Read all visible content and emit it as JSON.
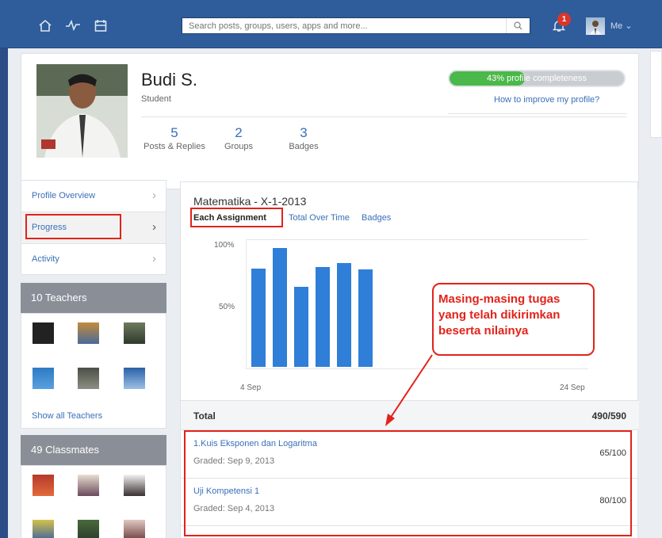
{
  "topbar": {
    "search_placeholder": "Search posts, groups, users, apps and more...",
    "notification_count": "1",
    "me_label": "Me ⌄"
  },
  "profile": {
    "name": "Budi S.",
    "role": "Student",
    "stats": [
      {
        "value": "5",
        "label": "Posts & Replies"
      },
      {
        "value": "2",
        "label": "Groups"
      },
      {
        "value": "3",
        "label": "Badges"
      }
    ],
    "completeness_text": "43% profile completeness",
    "completeness_value": 43,
    "improve_link": "How to improve my profile?"
  },
  "side_menu": [
    {
      "label": "Profile Overview"
    },
    {
      "label": "Progress"
    },
    {
      "label": "Activity"
    }
  ],
  "teachers": {
    "header": "10 Teachers",
    "show_all": "Show all Teachers"
  },
  "classmates": {
    "header": "49 Classmates"
  },
  "main": {
    "course_title": "Matematika - X-1-2013",
    "tabs": [
      "Each Assignment",
      "Total Over Time",
      "Badges"
    ],
    "total_label": "Total",
    "total_value": "490/590",
    "assignments": [
      {
        "title": "1.Kuis Eksponen dan Logaritma",
        "date": "Graded: Sep 9, 2013",
        "score": "65/100"
      },
      {
        "title": "Uji Kompetensi 1",
        "date": "Graded: Sep 4, 2013",
        "score": "80/100"
      }
    ]
  },
  "annotation": {
    "line1": "Masing-masing tugas",
    "line2": "yang telah dikirimkan",
    "line3": "beserta nilainya"
  },
  "chart_data": {
    "type": "bar",
    "x_tick_labels": [
      "4 Sep",
      "24 Sep"
    ],
    "y_tick_labels": [
      "100%",
      "50%"
    ],
    "values": [
      85,
      103,
      69,
      86,
      90,
      84
    ],
    "ylim": [
      0,
      100
    ],
    "color": "#2f7ed8"
  }
}
